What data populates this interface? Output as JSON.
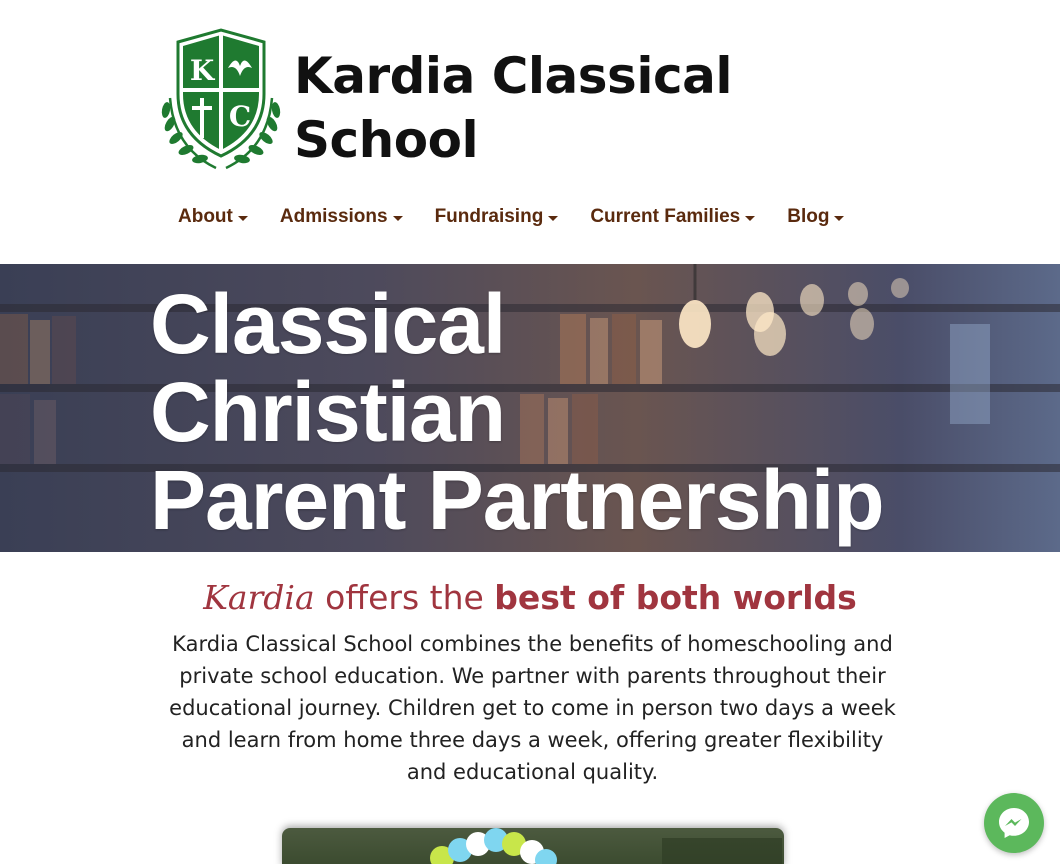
{
  "site": {
    "name": "Kardia Classical School",
    "logo": {
      "initials_top_left": "K",
      "initials_bottom_right": "C",
      "brand_color": "#1f7a30"
    }
  },
  "nav": {
    "items": [
      {
        "label": "About"
      },
      {
        "label": "Admissions"
      },
      {
        "label": "Fundraising"
      },
      {
        "label": "Current Families"
      },
      {
        "label": "Blog"
      }
    ],
    "color": "#5a2a0e"
  },
  "hero": {
    "lines": [
      "Classical",
      "Christian",
      "Parent Partnership"
    ]
  },
  "intro": {
    "tagline_em": "Kardia",
    "tagline_mid": " offers the ",
    "tagline_strong": "best of both worlds",
    "body": "Kardia Classical School combines the benefits of homeschooling and private school education. We partner with parents throughout their educational journey. Children get to come in person two days a week and learn from home three days a week, offering greater flexibility and educational quality.",
    "accent_color": "#a0353f"
  },
  "widgets": {
    "messenger_icon": "messenger-icon",
    "messenger_color": "#5cb85c"
  }
}
